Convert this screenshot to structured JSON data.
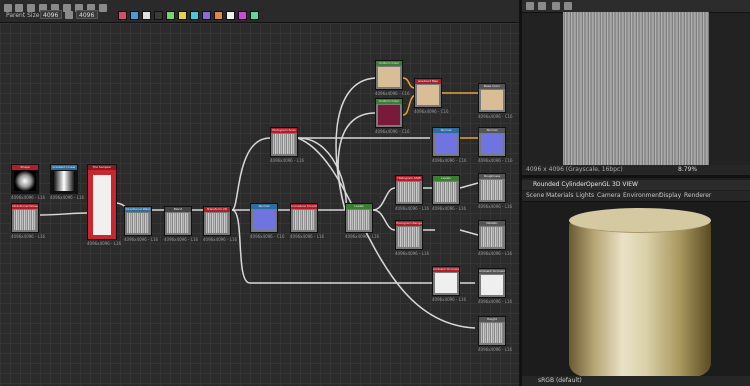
{
  "toolbar": {
    "parent_size_label": "Parent Size:",
    "parent_size_value": "4096",
    "size_value": "4096",
    "swatch_colors": [
      "#d94b6b",
      "#4b9bd9",
      "#e0e0e0",
      "#3a3a3a",
      "#7bd16f",
      "#e3d34a",
      "#4ac7d9",
      "#8a6bd9",
      "#d98a4b",
      "#f0f0f0",
      "#c94ad9",
      "#5ad99b"
    ]
  },
  "graph": {
    "nodes": [
      {
        "title": "Shape",
        "label": "4096x4096 - L16"
      },
      {
        "title": "Gradient Linear",
        "label": "4096x4096 - L16"
      },
      {
        "title": "Directional Noise",
        "label": "4096x4096 - L16"
      },
      {
        "title": "Tile Sampler",
        "label": "4096x4096 - L16"
      },
      {
        "title": "Directional Warp",
        "label": "4096x4096 - L16"
      },
      {
        "title": "Blend",
        "label": "4096x4096 - L16"
      },
      {
        "title": "Transform 2D",
        "label": "4096x4096 - L16"
      },
      {
        "title": "Histogram Scan",
        "label": "4096x4096 - L16"
      },
      {
        "title": "Normal",
        "label": "4096x4096 - C16"
      },
      {
        "title": "Curvature Smooth",
        "label": "4096x4096 - L16"
      },
      {
        "title": "Uniform Color",
        "label": "4096x4096 - C16"
      },
      {
        "title": "Uniform Color",
        "label": "4096x4096 - C16"
      },
      {
        "title": "Gradient Map",
        "label": "4096x4096 - C16"
      },
      {
        "title": "Normal",
        "label": "4096x4096 - C16"
      },
      {
        "title": "Levels",
        "label": "4096x4096 - L16"
      },
      {
        "title": "Histogram Shift",
        "label": "4096x4096 - L16"
      },
      {
        "title": "Levels",
        "label": "4096x4096 - L16"
      },
      {
        "title": "Histogram Range",
        "label": "4096x4096 - L16"
      },
      {
        "title": "Ambient Occlusion",
        "label": "4096x4096 - L16"
      }
    ],
    "outputs": [
      {
        "title": "Base Color",
        "label": "4096x4096 - C16"
      },
      {
        "title": "Normal",
        "label": "4096x4096 - C16"
      },
      {
        "title": "Roughness",
        "label": "4096x4096 - L16"
      },
      {
        "title": "Metallic",
        "label": "4096x4096 - L16"
      },
      {
        "title": "Ambient Occlusion",
        "label": "4096x4096 - L16"
      },
      {
        "title": "Height",
        "label": "4096x4096 - L16"
      }
    ]
  },
  "preview2d": {
    "status": "4096 x 4096 (Grayscale, 16bpc)",
    "zoom": "8.79%"
  },
  "view3d": {
    "title": "Rounded Cylinder",
    "renderer": "OpenGL",
    "mode": "3D VIEW",
    "menu": [
      "Scene",
      "Materials",
      "Lights",
      "Camera",
      "Environment",
      "Display",
      "Renderer"
    ],
    "colorspace": "sRGB (default)"
  }
}
